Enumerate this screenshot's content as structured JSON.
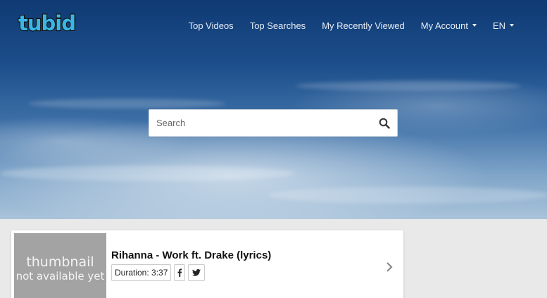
{
  "brand": {
    "logo_text": "tubidy",
    "colors": {
      "logo_fill": "#39b6e5",
      "logo_outline": "#111111",
      "hero_top": "#0f3a73"
    }
  },
  "nav": {
    "items": [
      {
        "label": "Top Videos"
      },
      {
        "label": "Top Searches"
      },
      {
        "label": "My Recently Viewed"
      },
      {
        "label": "My Account",
        "dropdown": true
      },
      {
        "label": "EN",
        "dropdown": true
      }
    ]
  },
  "search": {
    "placeholder": "Search",
    "value": "",
    "icon": "search-icon"
  },
  "results": [
    {
      "thumbnail_line1": "thumbnail",
      "thumbnail_line2": "not available yet",
      "title": "Rihanna - Work ft. Drake (lyrics)",
      "duration": "Duration: 3:37",
      "share_icons": [
        "facebook-icon",
        "twitter-icon"
      ],
      "chevron_icon": "chevron-right-icon"
    }
  ]
}
